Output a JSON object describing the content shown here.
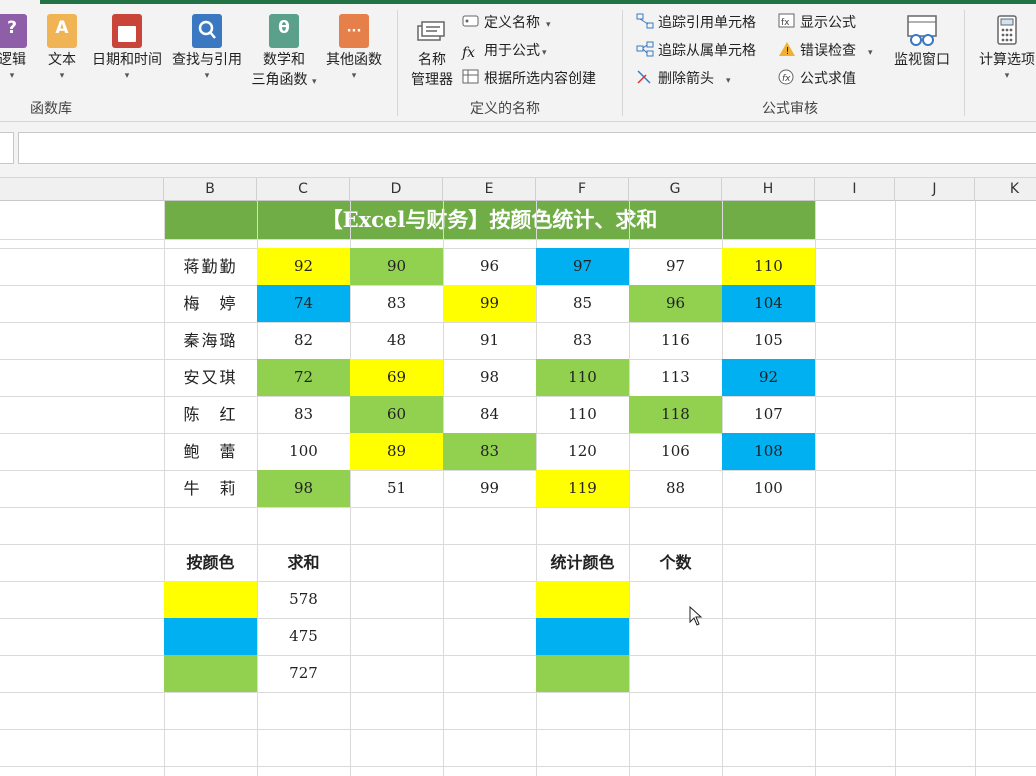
{
  "ribbon": {
    "groups": {
      "function_library": "函数库",
      "defined_names": "定义的名称",
      "formula_auditing": "公式审核"
    },
    "buttons": {
      "logical": "逻辑",
      "text": "文本",
      "datetime": "日期和时间",
      "lookup": "查找与引用",
      "math_line1": "数学和",
      "math_line2": "三角函数",
      "more": "其他函数",
      "name_mgr_line1": "名称",
      "name_mgr_line2": "管理器",
      "define_name": "定义名称",
      "use_in_formula": "用于公式",
      "create_from_sel": "根据所选内容创建",
      "trace_precedents": "追踪引用单元格",
      "trace_dependents": "追踪从属单元格",
      "remove_arrows": "删除箭头",
      "show_formulas": "显示公式",
      "error_check": "错误检查",
      "eval_formula": "公式求值",
      "watch_window": "监视窗口",
      "calc_options": "计算选项"
    },
    "icon_glyphs": {
      "logical": "?",
      "text": "A",
      "math": "θ",
      "more": "···"
    }
  },
  "columns": [
    "B",
    "C",
    "D",
    "E",
    "F",
    "G",
    "H",
    "I",
    "J",
    "K"
  ],
  "sheet": {
    "title": "【Excel与财务】按颜色统计、求和",
    "rows": [
      {
        "name": "蒋勤勤",
        "values": [
          92,
          90,
          96,
          97,
          97,
          110
        ]
      },
      {
        "name": "梅　婷",
        "values": [
          74,
          83,
          99,
          85,
          96,
          104
        ]
      },
      {
        "name": "秦海璐",
        "values": [
          82,
          48,
          91,
          83,
          116,
          105
        ]
      },
      {
        "name": "安又琪",
        "values": [
          72,
          69,
          98,
          110,
          113,
          92
        ]
      },
      {
        "name": "陈　红",
        "values": [
          83,
          60,
          84,
          110,
          118,
          107
        ]
      },
      {
        "name": "鲍　蕾",
        "values": [
          100,
          89,
          83,
          120,
          106,
          108
        ]
      },
      {
        "name": "牛　莉",
        "values": [
          98,
          51,
          99,
          119,
          88,
          100
        ]
      }
    ],
    "fills": [
      [
        "yellow",
        "green",
        "",
        "blue",
        "",
        "yellow"
      ],
      [
        "blue",
        "",
        "yellow",
        "",
        "green",
        "blue"
      ],
      [
        "",
        "",
        "",
        "",
        "",
        ""
      ],
      [
        "green",
        "yellow",
        "",
        "green",
        "",
        "blue"
      ],
      [
        "",
        "green",
        "",
        "",
        "green",
        ""
      ],
      [
        "",
        "yellow",
        "green",
        "",
        "",
        "blue"
      ],
      [
        "green",
        "",
        "",
        "yellow",
        "",
        ""
      ]
    ],
    "sum_table": {
      "header_color": "按颜色",
      "header_sum": "求和",
      "rows": [
        {
          "color": "yellow",
          "value": "578"
        },
        {
          "color": "blue",
          "value": "475"
        },
        {
          "color": "green",
          "value": "727"
        }
      ]
    },
    "count_table": {
      "header_color": "统计颜色",
      "header_count": "个数",
      "rows": [
        {
          "color": "yellow",
          "value": ""
        },
        {
          "color": "blue",
          "value": ""
        },
        {
          "color": "green",
          "value": ""
        }
      ]
    }
  },
  "colors": {
    "yellow": "#ffff00",
    "green": "#92d050",
    "blue": "#00b0f0",
    "title_bg": "#70ad47",
    "excel_green": "#217346"
  }
}
